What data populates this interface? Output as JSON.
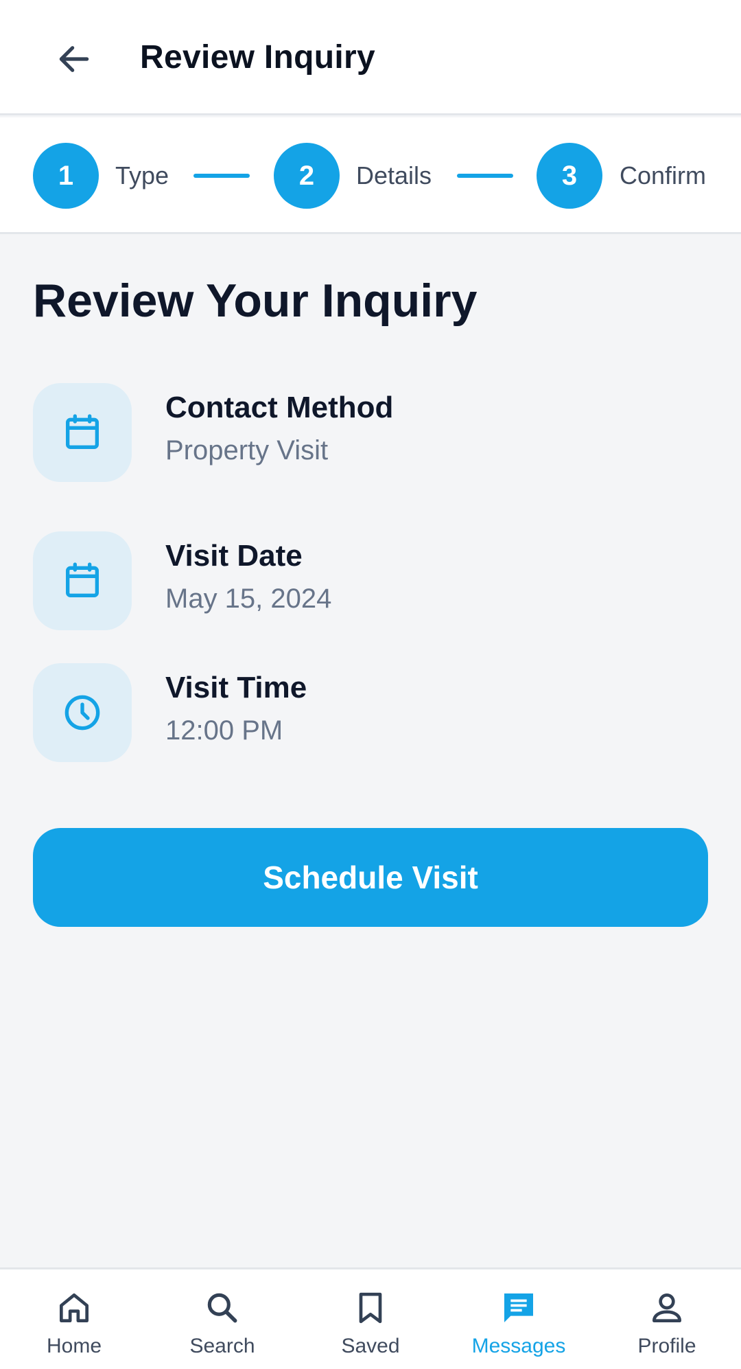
{
  "header": {
    "title": "Review Inquiry",
    "back_icon": "arrow-left-icon"
  },
  "stepper": {
    "steps": [
      {
        "number": "1",
        "label": "Type"
      },
      {
        "number": "2",
        "label": "Details"
      },
      {
        "number": "3",
        "label": "Confirm"
      }
    ]
  },
  "main": {
    "title": "Review Your Inquiry",
    "items": [
      {
        "icon": "calendar-icon",
        "label": "Contact Method",
        "value": "Property Visit"
      },
      {
        "icon": "calendar-icon",
        "label": "Visit Date",
        "value": "May 15, 2024"
      },
      {
        "icon": "clock-icon",
        "label": "Visit Time",
        "value": "12:00 PM"
      }
    ],
    "primary_button": "Schedule Visit"
  },
  "bottom_nav": {
    "items": [
      {
        "icon": "home-icon",
        "label": "Home"
      },
      {
        "icon": "search-icon",
        "label": "Search"
      },
      {
        "icon": "bookmark-icon",
        "label": "Saved"
      },
      {
        "icon": "message-icon",
        "label": "Messages"
      },
      {
        "icon": "person-icon",
        "label": "Profile"
      }
    ],
    "active": "Messages"
  },
  "colors": {
    "accent": "#14a3e6",
    "icon_bg": "#dfeef7",
    "text_primary": "#0f172a",
    "text_secondary": "#677489"
  }
}
